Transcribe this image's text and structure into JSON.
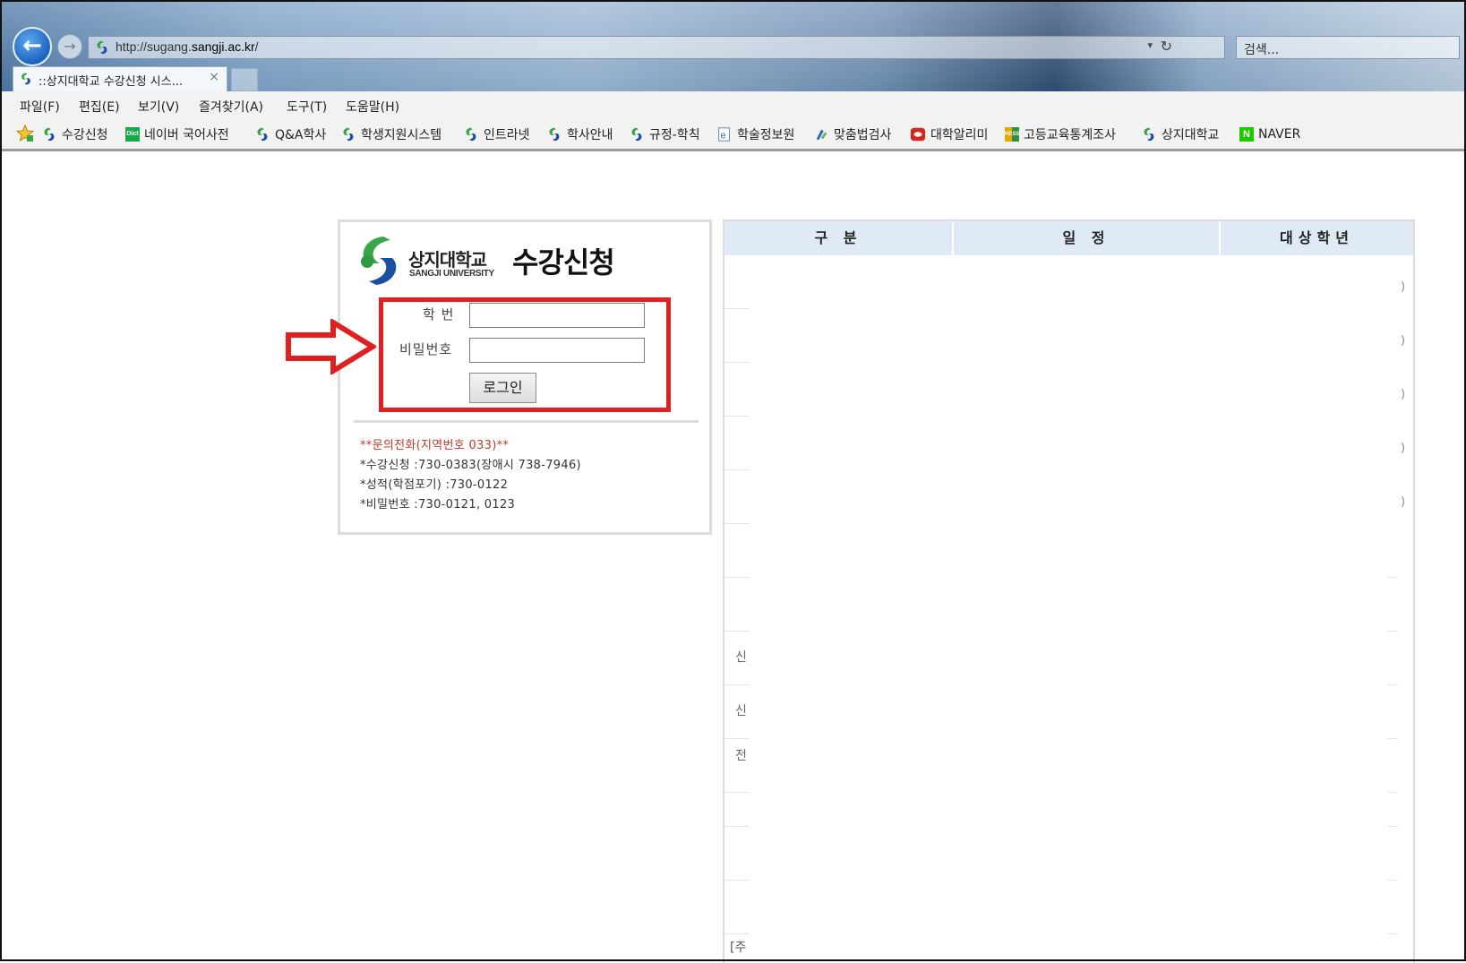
{
  "browser": {
    "url_prefix": "http://sugang.",
    "url_domain": "sangji.ac.kr",
    "url_suffix": "/",
    "search_placeholder": "검색...",
    "tab_title": "::상지대학교 수강신청 시스...",
    "tab_close": "×"
  },
  "menu": [
    "파일(F)",
    "편집(E)",
    "보기(V)",
    "즐겨찾기(A)",
    "도구(T)",
    "도움말(H)"
  ],
  "favorites": [
    {
      "label": "수강신청",
      "icon": "sangji-logo-icon"
    },
    {
      "label": "네이버 국어사전",
      "icon": "dict-icon",
      "icon_text": "Dict"
    },
    {
      "label": "Q&A학사",
      "icon": "sangji-logo-icon"
    },
    {
      "label": "학생지원시스템",
      "icon": "sangji-logo-icon"
    },
    {
      "label": "인트라넷",
      "icon": "sangji-logo-icon"
    },
    {
      "label": "학사안내",
      "icon": "sangji-logo-icon"
    },
    {
      "label": "규정-학칙",
      "icon": "sangji-logo-icon"
    },
    {
      "label": "학술정보원",
      "icon": "ie-page-icon"
    },
    {
      "label": "맞춤법검사",
      "icon": "spellcheck-icon"
    },
    {
      "label": "대학알리미",
      "icon": "red-oval-icon"
    },
    {
      "label": "고등교육통계조사",
      "icon": "stats-icon",
      "icon_text": "HESS"
    },
    {
      "label": "상지대학교",
      "icon": "sangji-logo-icon"
    },
    {
      "label": "NAVER",
      "icon": "naver-icon",
      "icon_text": "N"
    }
  ],
  "login": {
    "university_name": "상지대학교",
    "university_name_en": "SANGJI UNIVERSITY",
    "system_title": "수강신청",
    "student_id_label": "학 번",
    "password_label": "비밀번호",
    "student_id_value": "",
    "password_value": "",
    "login_button": "로그인",
    "contact_title": "**문의전화(지역번호 033)**",
    "contact_lines": [
      "*수강신청 :730-0383(장애시 738-7946)",
      "*성적(학점포기) :730-0122",
      "*비밀번호 :730-0121, 0123"
    ]
  },
  "schedule": {
    "headers": [
      "구 분",
      "일 정",
      "대상학년"
    ],
    "row_parens": [
      ")",
      ")",
      ")",
      ")",
      ")"
    ],
    "row_fragments": [
      "신",
      "신",
      "전"
    ],
    "footer_fragment": "[주"
  },
  "colors": {
    "highlight_red": "#e02020",
    "table_header_bg": "#dfeaf6",
    "contact_title": "#c0392b",
    "sangji_green": "#3aa64a",
    "sangji_blue": "#1b4fa0"
  }
}
